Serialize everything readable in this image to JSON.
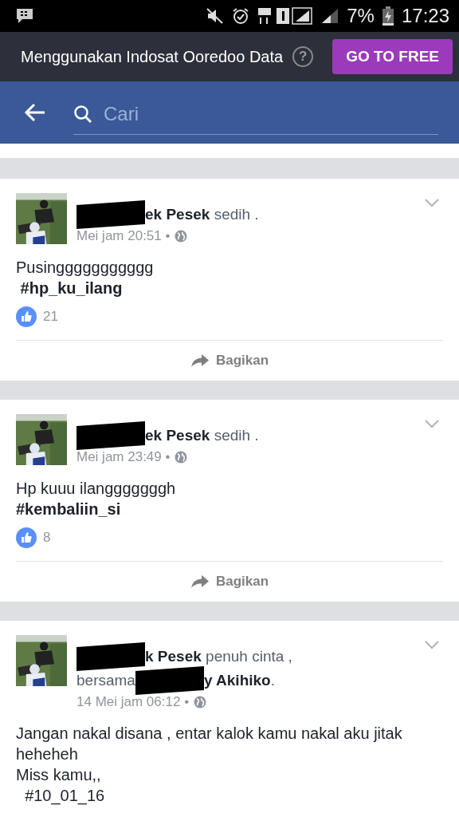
{
  "status_bar": {
    "battery": "7%",
    "time": "17:23"
  },
  "banner": {
    "text": "Menggunakan Indosat Ooredoo Data",
    "help": "?",
    "button": "GO TO FREE"
  },
  "search": {
    "placeholder": "Cari"
  },
  "posts": [
    {
      "header": [
        [
          {
            "kind": "redaction"
          },
          {
            "kind": "name",
            "text": "ek Pesek"
          },
          {
            "kind": "plain",
            "text": " sedih ."
          }
        ]
      ],
      "time": "Mei jam 20:51 •",
      "lines": [
        {
          "kind": "text",
          "text": "Pusinggggggggggg"
        },
        {
          "kind": "hashtag",
          "text": " #hp_ku_ilang"
        }
      ],
      "likes": "21",
      "share": "Bagikan"
    },
    {
      "header": [
        [
          {
            "kind": "redaction"
          },
          {
            "kind": "name",
            "text": "ek Pesek"
          },
          {
            "kind": "plain",
            "text": " sedih ."
          }
        ]
      ],
      "time": "Mei jam 23:49 •",
      "lines": [
        {
          "kind": "text",
          "text": "Hp kuuu ilangggggggh"
        },
        {
          "kind": "hashtag",
          "text": "#kembaliin_si"
        }
      ],
      "likes": "8",
      "share": "Bagikan"
    },
    {
      "header": [
        [
          {
            "kind": "redaction"
          },
          {
            "kind": "name",
            "text": "k Pesek"
          },
          {
            "kind": "plain",
            "text": " penuh cinta ,"
          }
        ],
        [
          {
            "kind": "plain",
            "text": "bersama"
          },
          {
            "kind": "redaction"
          },
          {
            "kind": "name",
            "text": "y Akihiko"
          },
          {
            "kind": "plain",
            "text": "."
          }
        ]
      ],
      "time": "14 Mei jam 06:12 •",
      "lines": [
        {
          "kind": "text",
          "text": "Jangan nakal disana , entar kalok kamu nakal aku jitak heheheh"
        },
        {
          "kind": "text",
          "text": "Miss kamu,,"
        },
        {
          "kind": "text",
          "text": "  #10_01_16"
        }
      ]
    }
  ]
}
